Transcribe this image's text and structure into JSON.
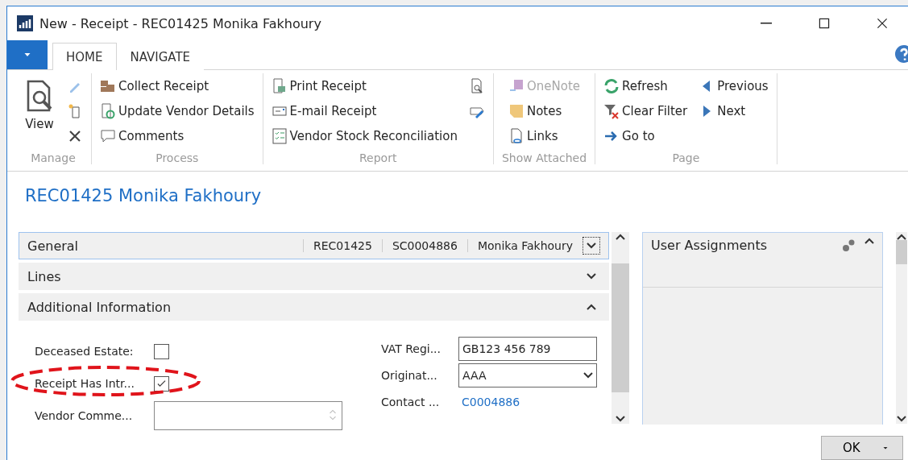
{
  "window": {
    "title": "New - Receipt - REC01425 Monika Fakhoury"
  },
  "tabs": [
    {
      "label": "HOME",
      "selected": true
    },
    {
      "label": "NAVIGATE",
      "selected": false
    }
  ],
  "ribbon": {
    "groups": [
      {
        "label": "Manage",
        "items": [
          {
            "kind": "large",
            "label": "View"
          },
          {
            "kind": "icon"
          },
          {
            "kind": "icon"
          },
          {
            "kind": "icon"
          }
        ]
      },
      {
        "label": "Process",
        "items": [
          {
            "kind": "small",
            "label": "Collect Receipt",
            "disabled": false
          },
          {
            "kind": "small",
            "label": "Update Vendor Details",
            "disabled": false
          },
          {
            "kind": "small",
            "label": "Comments",
            "disabled": false
          }
        ]
      },
      {
        "label": "Report",
        "items": [
          {
            "kind": "small",
            "label": "Print Receipt",
            "disabled": false
          },
          {
            "kind": "small",
            "label": "E-mail Receipt",
            "disabled": false
          },
          {
            "kind": "small",
            "label": "Vendor Stock Reconciliation",
            "disabled": false
          },
          {
            "kind": "icon"
          },
          {
            "kind": "icon"
          }
        ]
      },
      {
        "label": "Show Attached",
        "items": [
          {
            "kind": "small",
            "label": "OneNote",
            "disabled": true
          },
          {
            "kind": "small",
            "label": "Notes",
            "disabled": false
          },
          {
            "kind": "small",
            "label": "Links",
            "disabled": false
          }
        ]
      },
      {
        "label": "Page",
        "items": [
          {
            "kind": "small",
            "label": "Refresh",
            "disabled": false
          },
          {
            "kind": "small",
            "label": "Clear Filter",
            "disabled": false
          },
          {
            "kind": "small",
            "label": "Go to",
            "disabled": false
          },
          {
            "kind": "small",
            "label": "Previous",
            "disabled": false
          },
          {
            "kind": "small",
            "label": "Next",
            "disabled": false
          }
        ]
      }
    ]
  },
  "page_title": "REC01425 Monika Fakhoury",
  "fasttabs": [
    {
      "title": "General",
      "expanded": false,
      "focused": true,
      "summary": [
        "REC01425",
        "SC0004886",
        "Monika Fakhoury"
      ]
    },
    {
      "title": "Lines",
      "expanded": false,
      "focused": false
    },
    {
      "title": "Additional Information",
      "expanded": true,
      "focused": false,
      "left_fields": [
        {
          "kind": "checkbox",
          "label": "Deceased Estate:",
          "checked": false
        },
        {
          "kind": "checkbox",
          "label": "Receipt Has Intr...",
          "checked": true
        },
        {
          "kind": "textarea",
          "label": "Vendor Comme..."
        }
      ],
      "right_fields": [
        {
          "kind": "text",
          "label": "VAT Regi...",
          "value": "GB123 456 789"
        },
        {
          "kind": "select",
          "label": "Originat...",
          "value": "AAA"
        },
        {
          "kind": "link",
          "label": "Contact ...",
          "value": "C0004886"
        }
      ]
    }
  ],
  "factbox": {
    "title": "User Assignments",
    "expanded": true
  },
  "buttons": [
    {
      "label": "OK"
    }
  ]
}
